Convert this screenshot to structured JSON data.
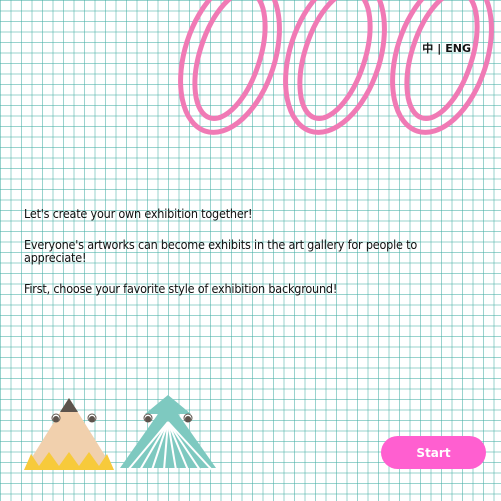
{
  "language_switch": {
    "zh": "中",
    "separator": "|",
    "en": "ENG"
  },
  "intro": {
    "line1": "Let's create your own exhibition together!",
    "line2": "Everyone's artworks can become exhibits in the art gallery for people to appreciate!",
    "line3": "First, choose your favorite style of exhibition background!"
  },
  "start_button": {
    "label": "Start"
  },
  "colors": {
    "accent": "#ff5fd0",
    "rings": "#f07ab5",
    "grid": "#46afa5",
    "pencil_body": "#f1d0ad",
    "pencil_tip": "#5c534c",
    "crayon_yellow": "#f7ca3b",
    "teal_mascot": "#7ec9c0"
  }
}
